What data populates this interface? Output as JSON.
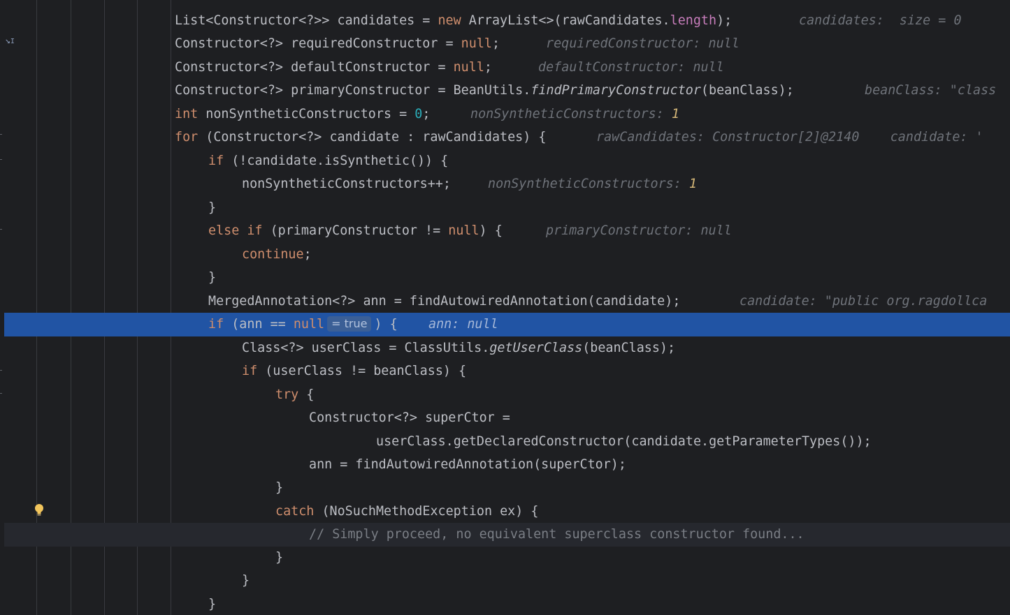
{
  "editor": {
    "lines": [
      {
        "id": "l1",
        "code": [
          [
            "plain",
            "List<Constructor<?>> candidates = "
          ],
          [
            "kw",
            "new"
          ],
          [
            "plain",
            " ArrayList<>(rawCandidates."
          ],
          [
            "field",
            "length"
          ],
          [
            "plain",
            ");"
          ]
        ],
        "hint": "candidates:  size = 0"
      },
      {
        "id": "l2",
        "code": [
          [
            "plain",
            "Constructor<?> requiredConstructor = "
          ],
          [
            "kw",
            "null"
          ],
          [
            "plain",
            ";"
          ]
        ],
        "hint": "requiredConstructor: null"
      },
      {
        "id": "l3",
        "code": [
          [
            "plain",
            "Constructor<?> defaultConstructor = "
          ],
          [
            "kw",
            "null"
          ],
          [
            "plain",
            ";"
          ]
        ],
        "hint": "defaultConstructor: null"
      },
      {
        "id": "l4",
        "code": [
          [
            "plain",
            "Constructor<?> primaryConstructor = BeanUtils."
          ],
          [
            "static",
            "findPrimaryConstructor"
          ],
          [
            "plain",
            "(beanClass);"
          ]
        ],
        "hint": "beanClass: \"class"
      },
      {
        "id": "l5",
        "code": [
          [
            "kw",
            "int"
          ],
          [
            "plain",
            " nonSyntheticConstructors = "
          ],
          [
            "num",
            "0"
          ],
          [
            "plain",
            ";"
          ]
        ],
        "hint": "nonSyntheticConstructors: ",
        "hint_num": "1"
      },
      {
        "id": "l6",
        "code": [
          [
            "kw",
            "for"
          ],
          [
            "plain",
            " (Constructor<?> candidate : rawCandidates) {"
          ]
        ],
        "hint": "rawCandidates: Constructor[2]@2140    candidate: '"
      },
      {
        "id": "l7",
        "code": [
          [
            "kw",
            "if"
          ],
          [
            "plain",
            " (!candidate.isSynthetic()) {"
          ]
        ],
        "hint": ""
      },
      {
        "id": "l8",
        "code": [
          [
            "plain",
            "nonSyntheticConstructors++;"
          ]
        ],
        "hint": "nonSyntheticConstructors: ",
        "hint_num": "1"
      },
      {
        "id": "l9",
        "code": [
          [
            "plain",
            "}"
          ]
        ],
        "hint": ""
      },
      {
        "id": "l10",
        "code": [
          [
            "kw",
            "else if"
          ],
          [
            "plain",
            " (primaryConstructor != "
          ],
          [
            "kw",
            "null"
          ],
          [
            "plain",
            ") {"
          ]
        ],
        "hint": "primaryConstructor: null"
      },
      {
        "id": "l11",
        "code": [
          [
            "kw",
            "continue"
          ],
          [
            "plain",
            ";"
          ]
        ],
        "hint": ""
      },
      {
        "id": "l12",
        "code": [
          [
            "plain",
            "}"
          ]
        ],
        "hint": ""
      },
      {
        "id": "l13",
        "code": [
          [
            "plain",
            "MergedAnnotation<?> ann = findAutowiredAnnotation(candidate);"
          ]
        ],
        "hint": "candidate: \"public org.ragdollca"
      },
      {
        "id": "l14",
        "code": [
          [
            "kw",
            "if"
          ],
          [
            "plain",
            " (ann == "
          ],
          [
            "kw",
            "null"
          ],
          [
            "inlay",
            "= true"
          ],
          [
            "plain",
            ") {"
          ]
        ],
        "hint": "ann: null"
      },
      {
        "id": "l15",
        "code": [
          [
            "plain",
            "Class<?> userClass = ClassUtils."
          ],
          [
            "static",
            "getUserClass"
          ],
          [
            "plain",
            "(beanClass);"
          ]
        ],
        "hint": ""
      },
      {
        "id": "l16",
        "code": [
          [
            "kw",
            "if"
          ],
          [
            "plain",
            " (userClass != beanClass) {"
          ]
        ],
        "hint": ""
      },
      {
        "id": "l17",
        "code": [
          [
            "kw",
            "try"
          ],
          [
            "plain",
            " {"
          ]
        ],
        "hint": ""
      },
      {
        "id": "l18",
        "code": [
          [
            "plain",
            "Constructor<?> superCtor ="
          ]
        ],
        "hint": ""
      },
      {
        "id": "l19",
        "code": [
          [
            "plain",
            "userClass.getDeclaredConstructor(candidate.getParameterTypes());"
          ]
        ],
        "hint": ""
      },
      {
        "id": "l20",
        "code": [
          [
            "plain",
            "ann = findAutowiredAnnotation(superCtor);"
          ]
        ],
        "hint": ""
      },
      {
        "id": "l21",
        "code": [
          [
            "plain",
            "}"
          ]
        ],
        "hint": ""
      },
      {
        "id": "l22",
        "code": [
          [
            "kw",
            "catch"
          ],
          [
            "plain",
            " (NoSuchMethodException ex) {"
          ]
        ],
        "hint": ""
      },
      {
        "id": "l23",
        "code": [
          [
            "comment",
            "// Simply proceed, no equivalent superclass constructor found..."
          ]
        ],
        "hint": ""
      },
      {
        "id": "l24",
        "code": [
          [
            "plain",
            "}"
          ]
        ],
        "hint": ""
      },
      {
        "id": "l25",
        "code": [
          [
            "plain",
            "}"
          ]
        ],
        "hint": ""
      },
      {
        "id": "l26",
        "code": [
          [
            "plain",
            "}"
          ]
        ],
        "hint": ""
      }
    ],
    "colors": {
      "background": "#1e1f22",
      "execution_line": "#2154a4",
      "keyword": "#cf8e6d",
      "number": "#2aacb8",
      "field": "#c77dbb",
      "comment": "#7a7e85",
      "hint": "#6f737a",
      "hint_number": "#d5b778"
    },
    "icons": {
      "gutter_marker": "step-into-marker-icon",
      "intention": "lightbulb-icon"
    }
  }
}
